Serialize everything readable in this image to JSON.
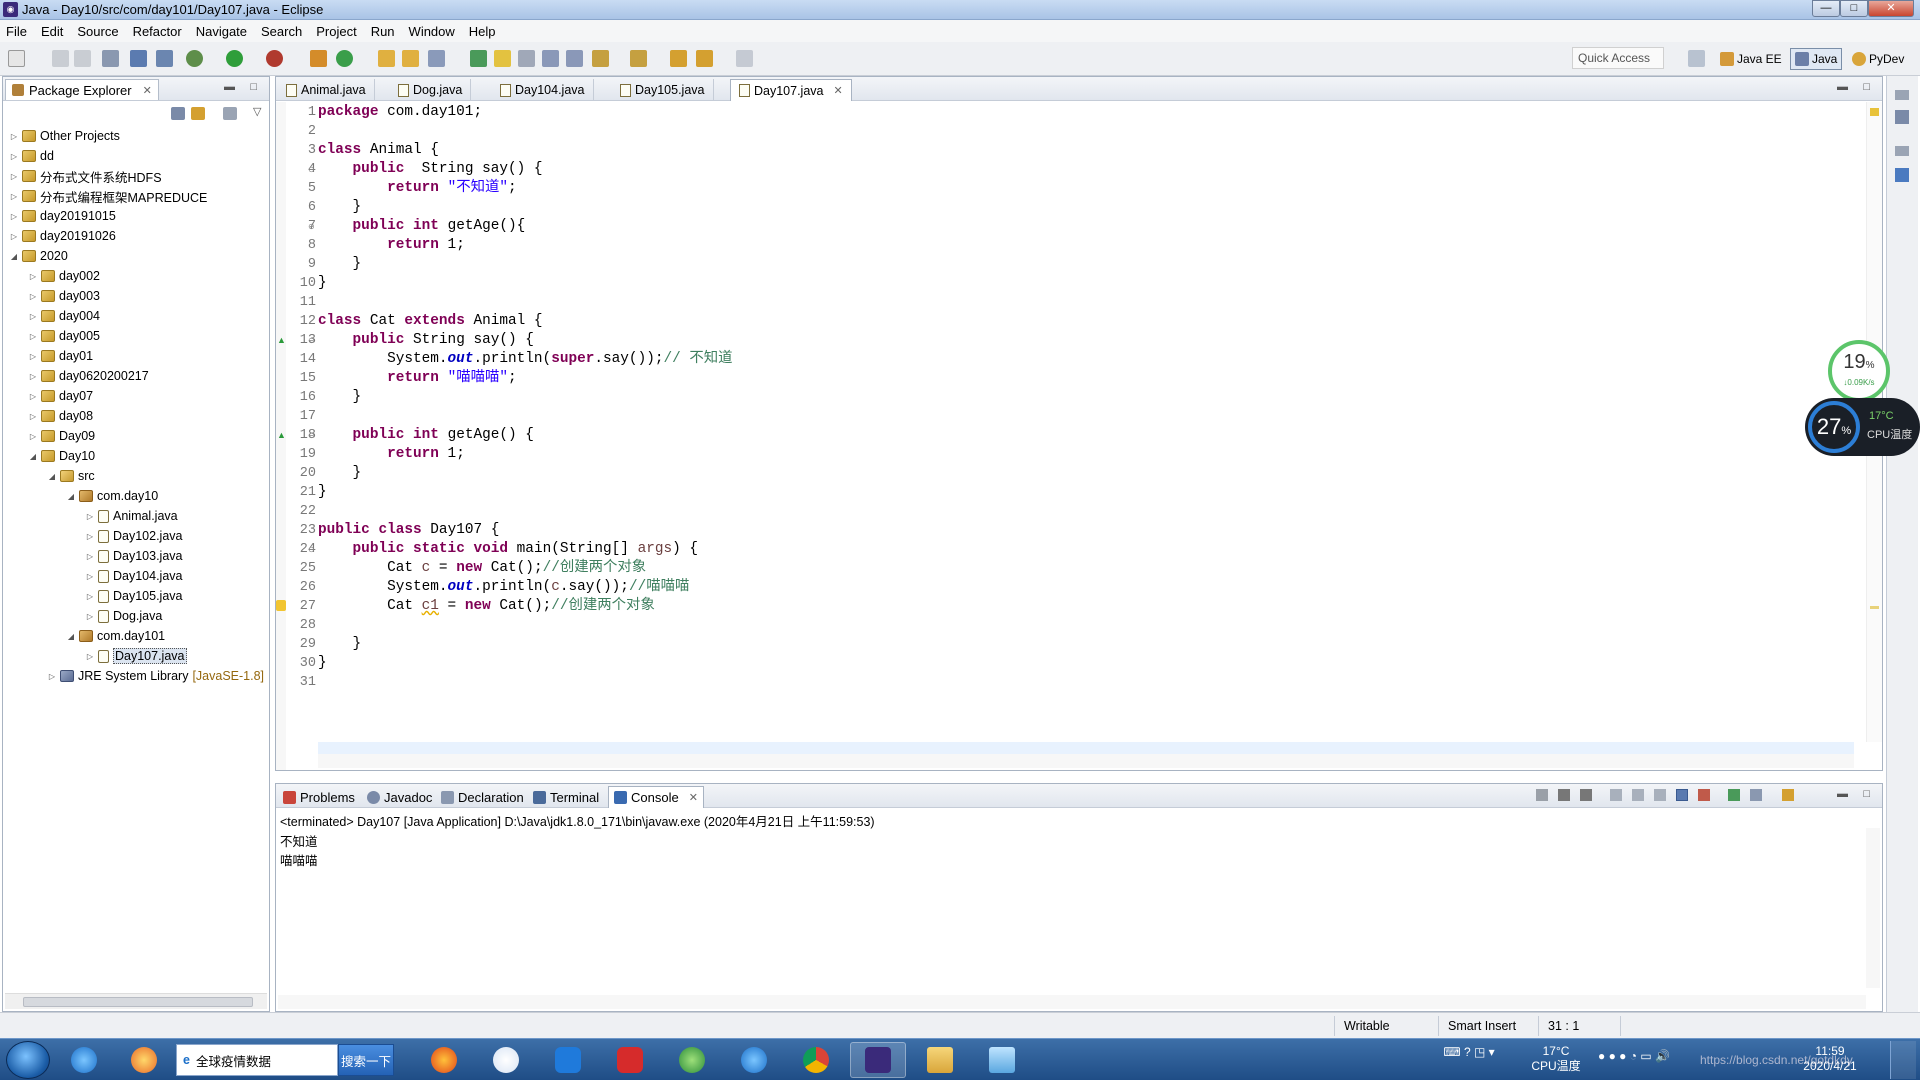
{
  "window": {
    "title": "Java - Day10/src/com/day101/Day107.java - Eclipse",
    "controls": [
      "—",
      "□",
      "✕"
    ]
  },
  "menu": [
    "File",
    "Edit",
    "Source",
    "Refactor",
    "Navigate",
    "Search",
    "Project",
    "Run",
    "Window",
    "Help"
  ],
  "toolbar": {
    "quick_access": "Quick Access",
    "perspectives": [
      "Java EE",
      "Java",
      "PyDev"
    ]
  },
  "package_explorer": {
    "title": "Package Explorer",
    "tree": [
      {
        "label": "Other Projects",
        "depth": 0,
        "expanded": false,
        "icon": "project-folder-icon"
      },
      {
        "label": "dd",
        "depth": 0,
        "expanded": false,
        "icon": "project-folder-icon"
      },
      {
        "label": "分布式文件系统HDFS",
        "depth": 0,
        "expanded": false,
        "icon": "project-folder-icon"
      },
      {
        "label": "分布式编程框架MAPREDUCE",
        "depth": 0,
        "expanded": false,
        "icon": "project-folder-icon"
      },
      {
        "label": "day20191015",
        "depth": 0,
        "expanded": false,
        "icon": "project-folder-icon"
      },
      {
        "label": "day20191026",
        "depth": 0,
        "expanded": false,
        "icon": "project-folder-icon"
      },
      {
        "label": "2020",
        "depth": 0,
        "expanded": true,
        "icon": "project-folder-icon"
      },
      {
        "label": "day002",
        "depth": 1,
        "expanded": false,
        "icon": "project-icon"
      },
      {
        "label": "day003",
        "depth": 1,
        "expanded": false,
        "icon": "project-icon"
      },
      {
        "label": "day004",
        "depth": 1,
        "expanded": false,
        "icon": "project-icon"
      },
      {
        "label": "day005",
        "depth": 1,
        "expanded": false,
        "icon": "project-icon"
      },
      {
        "label": "day01",
        "depth": 1,
        "expanded": false,
        "icon": "project-icon"
      },
      {
        "label": "day0620200217",
        "depth": 1,
        "expanded": false,
        "icon": "project-icon"
      },
      {
        "label": "day07",
        "depth": 1,
        "expanded": false,
        "icon": "project-icon"
      },
      {
        "label": "day08",
        "depth": 1,
        "expanded": false,
        "icon": "project-icon"
      },
      {
        "label": "Day09",
        "depth": 1,
        "expanded": false,
        "icon": "project-icon"
      },
      {
        "label": "Day10",
        "depth": 1,
        "expanded": true,
        "icon": "project-icon"
      },
      {
        "label": "src",
        "depth": 2,
        "expanded": true,
        "icon": "src-folder-icon"
      },
      {
        "label": "com.day10",
        "depth": 3,
        "expanded": true,
        "icon": "package-icon"
      },
      {
        "label": "Animal.java",
        "depth": 4,
        "expanded": false,
        "icon": "java-file-icon"
      },
      {
        "label": "Day102.java",
        "depth": 4,
        "expanded": false,
        "icon": "java-file-icon"
      },
      {
        "label": "Day103.java",
        "depth": 4,
        "expanded": false,
        "icon": "java-file-icon"
      },
      {
        "label": "Day104.java",
        "depth": 4,
        "expanded": false,
        "icon": "java-file-icon"
      },
      {
        "label": "Day105.java",
        "depth": 4,
        "expanded": false,
        "icon": "java-file-icon"
      },
      {
        "label": "Dog.java",
        "depth": 4,
        "expanded": false,
        "icon": "java-file-icon"
      },
      {
        "label": "com.day101",
        "depth": 3,
        "expanded": true,
        "icon": "package-icon"
      },
      {
        "label": "Day107.java",
        "depth": 4,
        "expanded": false,
        "icon": "java-file-icon",
        "selected": true
      },
      {
        "label": "JRE System Library",
        "suffix": "[JavaSE-1.8]",
        "depth": 2,
        "expanded": false,
        "icon": "library-icon"
      }
    ]
  },
  "editor": {
    "tabs": [
      {
        "label": "Animal.java",
        "active": false
      },
      {
        "label": "Dog.java",
        "active": false
      },
      {
        "label": "Day104.java",
        "active": false
      },
      {
        "label": "Day105.java",
        "active": false
      },
      {
        "label": "Day107.java",
        "active": true
      }
    ],
    "lines": [
      {
        "n": "1",
        "t": [
          [
            "kw",
            "package"
          ],
          [
            "p",
            " com.day101;"
          ]
        ]
      },
      {
        "n": "2",
        "t": []
      },
      {
        "n": "3",
        "t": [
          [
            "kw",
            "class"
          ],
          [
            "p",
            " Animal {"
          ]
        ]
      },
      {
        "n": "4",
        "fold": true,
        "t": [
          [
            "p",
            "    "
          ],
          [
            "kw",
            "public"
          ],
          [
            "p",
            "  String say() {"
          ]
        ]
      },
      {
        "n": "5",
        "t": [
          [
            "p",
            "        "
          ],
          [
            "kw",
            "return"
          ],
          [
            "p",
            " "
          ],
          [
            "str",
            "\"不知道\""
          ],
          [
            "p",
            ";"
          ]
        ]
      },
      {
        "n": "6",
        "t": [
          [
            "p",
            "    }"
          ]
        ]
      },
      {
        "n": "7",
        "fold": true,
        "t": [
          [
            "p",
            "    "
          ],
          [
            "kw",
            "public"
          ],
          [
            "p",
            " "
          ],
          [
            "kw",
            "int"
          ],
          [
            "p",
            " getAge(){"
          ]
        ]
      },
      {
        "n": "8",
        "t": [
          [
            "p",
            "        "
          ],
          [
            "kw",
            "return"
          ],
          [
            "p",
            " 1;"
          ]
        ]
      },
      {
        "n": "9",
        "t": [
          [
            "p",
            "    }"
          ]
        ]
      },
      {
        "n": "10",
        "t": [
          [
            "p",
            "}"
          ]
        ]
      },
      {
        "n": "11",
        "t": []
      },
      {
        "n": "12",
        "t": [
          [
            "kw",
            "class"
          ],
          [
            "p",
            " Cat "
          ],
          [
            "kw",
            "extends"
          ],
          [
            "p",
            " Animal {"
          ]
        ]
      },
      {
        "n": "13",
        "fold": true,
        "override": true,
        "t": [
          [
            "p",
            "    "
          ],
          [
            "kw",
            "public"
          ],
          [
            "p",
            " String say() {"
          ]
        ]
      },
      {
        "n": "14",
        "t": [
          [
            "p",
            "        System."
          ],
          [
            "fld",
            "out"
          ],
          [
            "p",
            ".println("
          ],
          [
            "kw",
            "super"
          ],
          [
            "p",
            ".say());"
          ],
          [
            "cm",
            "// 不知道"
          ]
        ]
      },
      {
        "n": "15",
        "t": [
          [
            "p",
            "        "
          ],
          [
            "kw",
            "return"
          ],
          [
            "p",
            " "
          ],
          [
            "str",
            "\"喵喵喵\""
          ],
          [
            "p",
            ";"
          ]
        ]
      },
      {
        "n": "16",
        "t": [
          [
            "p",
            "    }"
          ]
        ]
      },
      {
        "n": "17",
        "t": []
      },
      {
        "n": "18",
        "fold": true,
        "override": true,
        "t": [
          [
            "p",
            "    "
          ],
          [
            "kw",
            "public"
          ],
          [
            "p",
            " "
          ],
          [
            "kw",
            "int"
          ],
          [
            "p",
            " getAge() {"
          ]
        ]
      },
      {
        "n": "19",
        "t": [
          [
            "p",
            "        "
          ],
          [
            "kw",
            "return"
          ],
          [
            "p",
            " 1;"
          ]
        ]
      },
      {
        "n": "20",
        "t": [
          [
            "p",
            "    }"
          ]
        ]
      },
      {
        "n": "21",
        "t": [
          [
            "p",
            "}"
          ]
        ]
      },
      {
        "n": "22",
        "t": []
      },
      {
        "n": "23",
        "t": [
          [
            "kw",
            "public"
          ],
          [
            "p",
            " "
          ],
          [
            "kw",
            "class"
          ],
          [
            "p",
            " Day107 {"
          ]
        ]
      },
      {
        "n": "24",
        "fold": true,
        "t": [
          [
            "p",
            "    "
          ],
          [
            "kw",
            "public"
          ],
          [
            "p",
            " "
          ],
          [
            "kw",
            "static"
          ],
          [
            "p",
            " "
          ],
          [
            "kw",
            "void"
          ],
          [
            "p",
            " main(String[] "
          ],
          [
            "var",
            "args"
          ],
          [
            "p",
            ") {"
          ]
        ]
      },
      {
        "n": "25",
        "t": [
          [
            "p",
            "        Cat "
          ],
          [
            "var",
            "c"
          ],
          [
            "p",
            " = "
          ],
          [
            "kw",
            "new"
          ],
          [
            "p",
            " Cat();"
          ],
          [
            "cm",
            "//创建两个对象"
          ]
        ]
      },
      {
        "n": "26",
        "t": [
          [
            "p",
            "        System."
          ],
          [
            "fld",
            "out"
          ],
          [
            "p",
            ".println("
          ],
          [
            "var",
            "c"
          ],
          [
            "p",
            ".say());"
          ],
          [
            "cm",
            "//喵喵喵"
          ]
        ]
      },
      {
        "n": "27",
        "warn": true,
        "t": [
          [
            "p",
            "        Cat "
          ],
          [
            "var",
            "c1"
          ],
          [
            "p",
            " = "
          ],
          [
            "kw",
            "new"
          ],
          [
            "p",
            " Cat();"
          ],
          [
            "cm",
            "//创建两个对象"
          ]
        ]
      },
      {
        "n": "28",
        "t": []
      },
      {
        "n": "29",
        "t": [
          [
            "p",
            "    }"
          ]
        ]
      },
      {
        "n": "30",
        "t": [
          [
            "p",
            "}"
          ]
        ]
      },
      {
        "n": "31",
        "t": []
      }
    ]
  },
  "console": {
    "tabs": [
      {
        "label": "Problems",
        "active": false,
        "icon": "problems-icon"
      },
      {
        "label": "Javadoc",
        "active": false,
        "icon": "javadoc-icon"
      },
      {
        "label": "Declaration",
        "active": false,
        "icon": "declaration-icon"
      },
      {
        "label": "Terminal",
        "active": false,
        "icon": "terminal-icon"
      },
      {
        "label": "Console",
        "active": true,
        "icon": "console-icon"
      }
    ],
    "status": "<terminated> Day107 [Java Application] D:\\Java\\jdk1.8.0_171\\bin\\javaw.exe (2020年4月21日 上午11:59:53)",
    "output": [
      "不知道",
      "喵喵喵"
    ]
  },
  "statusbar": {
    "writable": "Writable",
    "insert_mode": "Smart Insert",
    "position": "31 : 1"
  },
  "taskbar": {
    "search_text": "全球疫情数据",
    "search_button": "搜索一下",
    "weather": "17°C",
    "weather_label": "CPU温度",
    "time": "11:59",
    "date": "2020/4/21",
    "watermark": "https://blog.csdn.net/gotdkdy"
  },
  "widget": {
    "net_percent": "19",
    "net_unit": "%",
    "net_speed": "↓0.09K/s",
    "cpu_percent": "27",
    "cpu_unit": "%",
    "cpu_temp": "17°C",
    "cpu_label": "CPU温度"
  }
}
